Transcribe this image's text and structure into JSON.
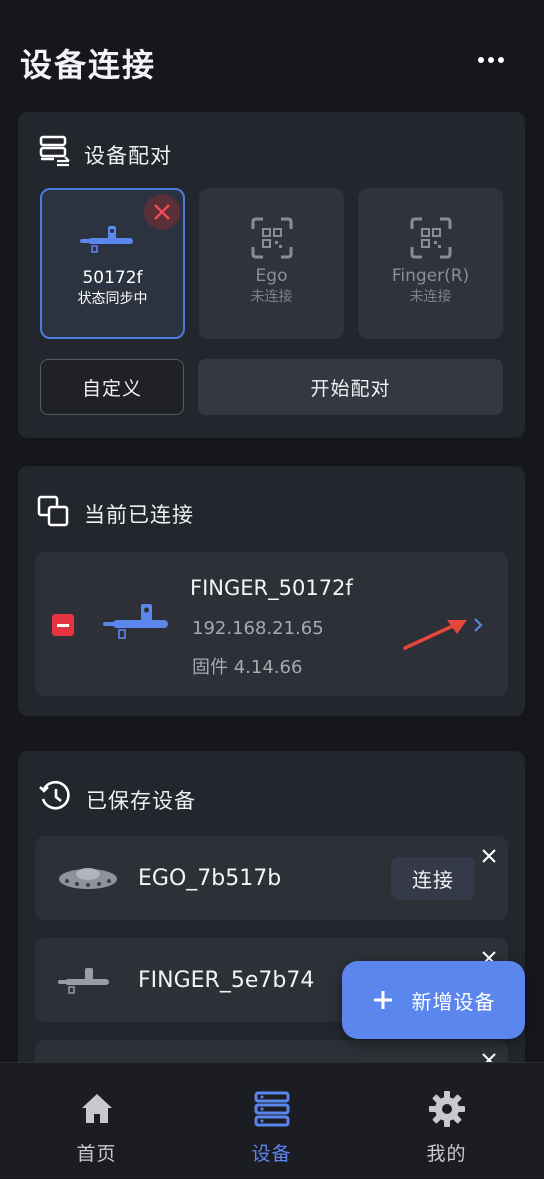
{
  "header": {
    "title": "设备连接"
  },
  "pairing": {
    "title": "设备配对",
    "tiles": [
      {
        "name": "50172f",
        "status": "状态同步中"
      },
      {
        "name": "Ego",
        "status": "未连接"
      },
      {
        "name": "Finger(R)",
        "status": "未连接"
      }
    ],
    "custom_label": "自定义",
    "start_label": "开始配对"
  },
  "connected": {
    "title": "当前已连接",
    "device": {
      "name": "FINGER_50172f",
      "ip": "192.168.21.65",
      "firmware": "固件 4.14.66"
    }
  },
  "saved": {
    "title": "已保存设备",
    "devices": [
      {
        "name": "EGO_7b517b",
        "connect_label": "连接"
      },
      {
        "name": "FINGER_5e7b74"
      }
    ]
  },
  "fab": {
    "label": "新增设备"
  },
  "tabs": [
    {
      "label": "首页"
    },
    {
      "label": "设备"
    },
    {
      "label": "我的"
    }
  ],
  "colors": {
    "accent": "#5b86ee",
    "danger": "#e5343f",
    "arrow": "#e8453c"
  }
}
